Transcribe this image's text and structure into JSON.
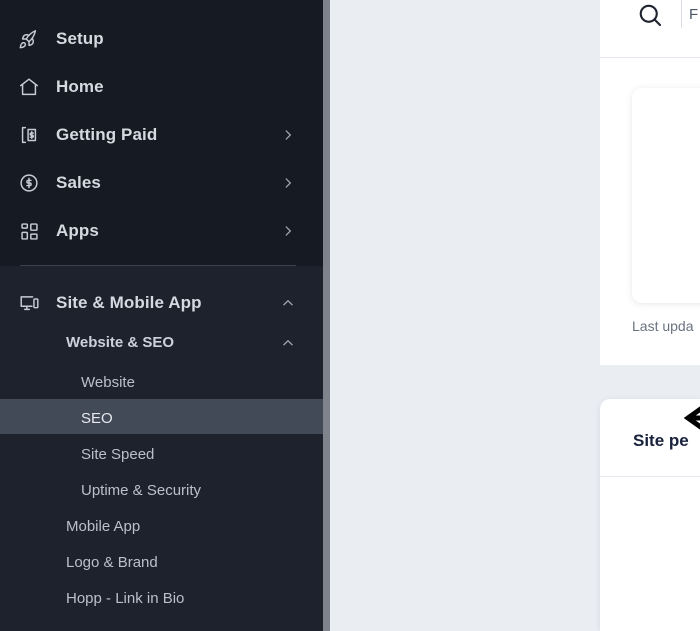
{
  "sidebar": {
    "background_color": "#151a23",
    "highlight_color": "#434a57",
    "text_color": "#d5d9e0",
    "items": [
      {
        "label": "Setup",
        "icon": "rocket-icon",
        "chevron": "none"
      },
      {
        "label": "Home",
        "icon": "home-icon",
        "chevron": "none"
      },
      {
        "label": "Getting Paid",
        "icon": "invoice-dollar-icon",
        "chevron": "right"
      },
      {
        "label": "Sales",
        "icon": "circle-dollar-icon",
        "chevron": "right"
      },
      {
        "label": "Apps",
        "icon": "grid-apps-icon",
        "chevron": "right"
      }
    ],
    "section": {
      "label": "Site & Mobile App",
      "icon": "monitor-mobile-icon",
      "chevron": "up",
      "subsections": [
        {
          "label": "Website & SEO",
          "chevron": "up",
          "items": [
            {
              "label": "Website",
              "selected": false
            },
            {
              "label": "SEO",
              "selected": true
            },
            {
              "label": "Site Speed",
              "selected": false
            },
            {
              "label": "Uptime & Security",
              "selected": false
            }
          ]
        },
        {
          "label": "Mobile App",
          "chevron": "none",
          "items": []
        },
        {
          "label": "Logo & Brand",
          "chevron": "none",
          "items": []
        },
        {
          "label": "Hopp - Link in Bio",
          "chevron": "none",
          "items": []
        }
      ]
    }
  },
  "header": {
    "search_icon": "search-icon",
    "text": "F"
  },
  "main": {
    "background_color": "#eaedf2",
    "panel_one": {
      "last_updated": "Last upda"
    },
    "panel_two": {
      "title": "Site pe"
    }
  },
  "annotation": {
    "arrow": "left-arrow-icon",
    "color": "#000000"
  }
}
